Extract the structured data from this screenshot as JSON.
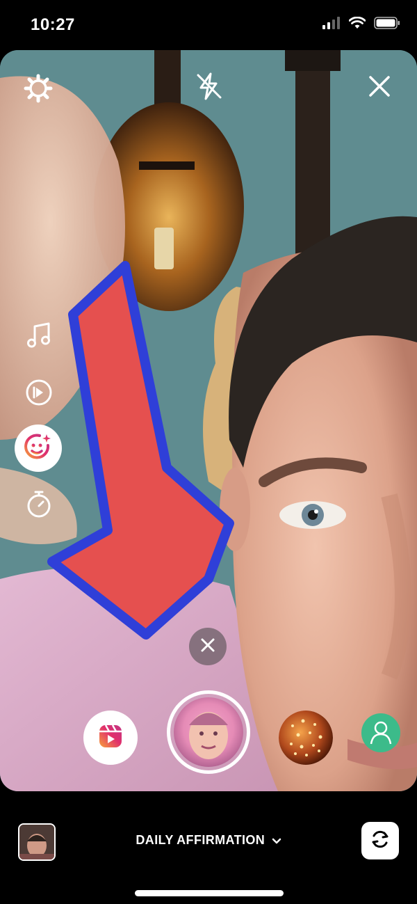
{
  "status": {
    "time": "10:27"
  },
  "bottom": {
    "mode_label": "DAILY AFFIRMATION"
  },
  "icons": {
    "settings": "gear-icon",
    "flash": "flash-off-icon",
    "close": "close-icon",
    "music": "music-note-icon",
    "boomerang": "play-circle-icon",
    "effects": "sparkle-face-icon",
    "timer": "timer-icon",
    "clear_effect": "close-icon",
    "reels": "reels-icon",
    "flip": "flip-camera-icon",
    "dropdown": "chevron-down-icon"
  },
  "colors": {
    "wall": "#5f8c90",
    "shirt": "#d6a9c6",
    "arrow_fill": "#e5504f",
    "arrow_outline": "#2f3fd8",
    "accent_gradient_start": "#f7a23b",
    "accent_gradient_end": "#c13584"
  }
}
